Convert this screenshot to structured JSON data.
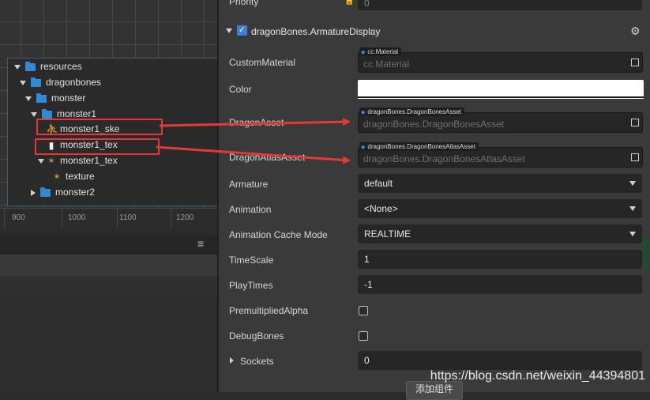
{
  "scene": {
    "ruler_ticks": [
      "900",
      "1000",
      "1100",
      "1200"
    ]
  },
  "tree": {
    "items": [
      {
        "label": "resources",
        "kind": "folder",
        "expanded": true
      },
      {
        "label": "dragonbones",
        "kind": "folder",
        "expanded": true
      },
      {
        "label": "monster",
        "kind": "folder",
        "expanded": true
      },
      {
        "label": "monster1",
        "kind": "folder",
        "expanded": true
      },
      {
        "label": "monster1_ske",
        "kind": "skeleton-file",
        "highlighted": true
      },
      {
        "label": "monster1_tex",
        "kind": "json-file",
        "highlighted": true
      },
      {
        "label": "monster1_tex",
        "kind": "atlas",
        "expanded": true
      },
      {
        "label": "texture",
        "kind": "texture"
      },
      {
        "label": "monster2",
        "kind": "folder",
        "expanded": false
      }
    ]
  },
  "inspector": {
    "priority_label": "Priority",
    "priority_value": "0",
    "component_title": "dragonBones.ArmatureDisplay",
    "component_enabled": true,
    "custom_material": {
      "label": "CustomMaterial",
      "tag": "cc.Material",
      "placeholder": "cc.Material"
    },
    "color": {
      "label": "Color",
      "value": "#ffffff"
    },
    "dragon_asset": {
      "label": "DragonAsset",
      "tag": "dragonBones.DragonBonesAsset",
      "placeholder": "dragonBones.DragonBonesAsset"
    },
    "dragon_atlas_asset": {
      "label": "DragonAtlasAsset",
      "tag": "dragonBones.DragonBonesAtlasAsset",
      "placeholder": "dragonBones.DragonBonesAtlasAsset"
    },
    "armature": {
      "label": "Armature",
      "value": "default"
    },
    "animation": {
      "label": "Animation",
      "value": "<None>"
    },
    "animation_cache_mode": {
      "label": "Animation Cache Mode",
      "value": "REALTIME"
    },
    "time_scale": {
      "label": "TimeScale",
      "value": "1"
    },
    "play_times": {
      "label": "PlayTimes",
      "value": "-1"
    },
    "premultiplied_alpha": {
      "label": "PremultipliedAlpha",
      "checked": false
    },
    "debug_bones": {
      "label": "DebugBones",
      "checked": false
    },
    "sockets": {
      "label": "Sockets",
      "value": "0"
    },
    "add_component_label": "添加组件"
  },
  "watermark": "https://blog.csdn.net/weixin_44394801",
  "colors": {
    "accent": "#2f8bd6",
    "highlight_red": "#e53935",
    "panel_bg": "#3a3a3a",
    "field_bg": "#262626"
  }
}
